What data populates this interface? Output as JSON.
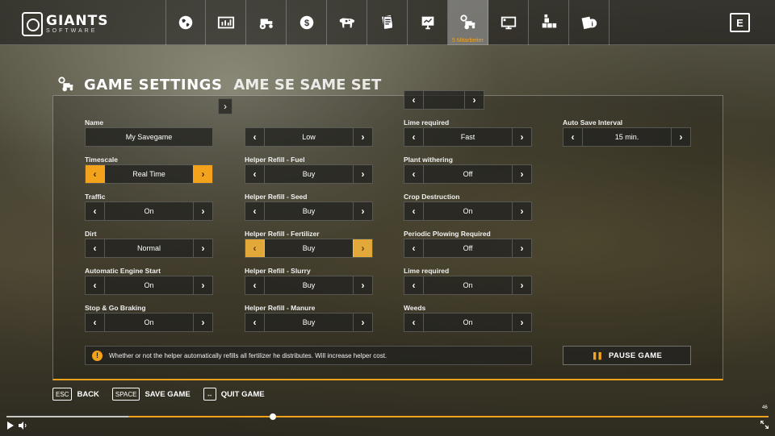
{
  "logo": {
    "brand": "GIANTS",
    "sub": "SOFTWARE"
  },
  "tabs": [
    {
      "name": "tab-map",
      "icon": "globe-icon"
    },
    {
      "name": "tab-prices",
      "icon": "chart-icon"
    },
    {
      "name": "tab-vehicles",
      "icon": "tractor-icon"
    },
    {
      "name": "tab-finances",
      "icon": "money-icon"
    },
    {
      "name": "tab-animals",
      "icon": "cow-icon"
    },
    {
      "name": "tab-contracts",
      "icon": "contracts-icon"
    },
    {
      "name": "tab-statistics",
      "icon": "presentation-icon"
    },
    {
      "name": "tab-game-settings",
      "icon": "settings-tractor-icon",
      "active": true,
      "sub": "5 Mitarbeiter"
    },
    {
      "name": "tab-general-settings",
      "icon": "monitor-icon"
    },
    {
      "name": "tab-controls",
      "icon": "blocks-icon"
    },
    {
      "name": "tab-help",
      "icon": "help-icon"
    }
  ],
  "exit_key": "E",
  "page": {
    "title": "GAME SETTINGS",
    "ghost_title": "AME SE SAME SET"
  },
  "settings": {
    "col1": [
      {
        "label": "Name",
        "value": "My Savegame",
        "type": "text"
      },
      {
        "label": "Timescale",
        "value": "Real Time",
        "highlight": true
      },
      {
        "label": "Traffic",
        "value": "On"
      },
      {
        "label": "Dirt",
        "value": "Normal"
      },
      {
        "label": "Automatic Engine Start",
        "value": "On"
      },
      {
        "label": "Stop & Go Braking",
        "value": "On"
      }
    ],
    "col2": [
      {
        "label": "",
        "value": "Low"
      },
      {
        "label": "Helper Refill - Fuel",
        "value": "Buy"
      },
      {
        "label": "Helper Refill - Seed",
        "value": "Buy"
      },
      {
        "label": "Helper Refill - Fertilizer",
        "value": "Buy",
        "highlight": true
      },
      {
        "label": "Helper Refill - Slurry",
        "value": "Buy"
      },
      {
        "label": "Helper Refill - Manure",
        "value": "Buy"
      }
    ],
    "col3": [
      {
        "label": "Lime required",
        "value": "Fast"
      },
      {
        "label": "Plant withering",
        "value": "Off"
      },
      {
        "label": "Crop Destruction",
        "value": "On"
      },
      {
        "label": "Periodic Plowing Required",
        "value": "Off"
      },
      {
        "label": "Lime required",
        "value": "On"
      },
      {
        "label": "Weeds",
        "value": "On"
      }
    ],
    "col4": [
      {
        "label": "Auto Save Interval",
        "value": "15 min."
      }
    ]
  },
  "info": {
    "icon": "!",
    "text": "Whether or not the helper automatically refills all fertilizer he distributes. Will increase helper cost."
  },
  "pause_button": {
    "icon": "❚❚",
    "label": "PAUSE GAME"
  },
  "actions": [
    {
      "key": "ESC",
      "label": "BACK"
    },
    {
      "key": "SPACE",
      "label": "SAVE GAME"
    },
    {
      "key": "↔",
      "label": "QUIT GAME"
    }
  ],
  "video": {
    "time": "46",
    "progress": 0.35,
    "buffered": 0.16
  },
  "colors": {
    "accent": "#f3a21b",
    "panel": "#23231f"
  }
}
